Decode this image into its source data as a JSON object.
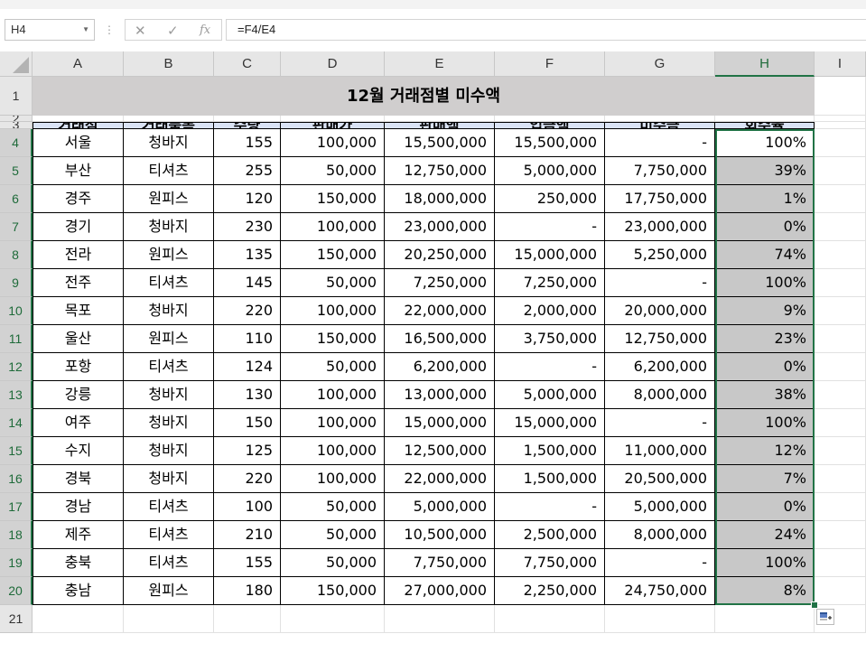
{
  "name_box": "H4",
  "formula": "=F4/E4",
  "columns": [
    "A",
    "B",
    "C",
    "D",
    "E",
    "F",
    "G",
    "H",
    "I"
  ],
  "title": "12월 거래점별 미수액",
  "headers": [
    "거래점",
    "거래품목",
    "수량",
    "판매가",
    "판매액",
    "입금액",
    "미수금",
    "회수율"
  ],
  "rows": [
    [
      "서울",
      "청바지",
      "155",
      "100,000",
      "15,500,000",
      "15,500,000",
      "-",
      "100%"
    ],
    [
      "부산",
      "티셔츠",
      "255",
      "50,000",
      "12,750,000",
      "5,000,000",
      "7,750,000",
      "39%"
    ],
    [
      "경주",
      "원피스",
      "120",
      "150,000",
      "18,000,000",
      "250,000",
      "17,750,000",
      "1%"
    ],
    [
      "경기",
      "청바지",
      "230",
      "100,000",
      "23,000,000",
      "-",
      "23,000,000",
      "0%"
    ],
    [
      "전라",
      "원피스",
      "135",
      "150,000",
      "20,250,000",
      "15,000,000",
      "5,250,000",
      "74%"
    ],
    [
      "전주",
      "티셔츠",
      "145",
      "50,000",
      "7,250,000",
      "7,250,000",
      "-",
      "100%"
    ],
    [
      "목포",
      "청바지",
      "220",
      "100,000",
      "22,000,000",
      "2,000,000",
      "20,000,000",
      "9%"
    ],
    [
      "울산",
      "원피스",
      "110",
      "150,000",
      "16,500,000",
      "3,750,000",
      "12,750,000",
      "23%"
    ],
    [
      "포항",
      "티셔츠",
      "124",
      "50,000",
      "6,200,000",
      "-",
      "6,200,000",
      "0%"
    ],
    [
      "강릉",
      "청바지",
      "130",
      "100,000",
      "13,000,000",
      "5,000,000",
      "8,000,000",
      "38%"
    ],
    [
      "여주",
      "청바지",
      "150",
      "100,000",
      "15,000,000",
      "15,000,000",
      "-",
      "100%"
    ],
    [
      "수지",
      "청바지",
      "125",
      "100,000",
      "12,500,000",
      "1,500,000",
      "11,000,000",
      "12%"
    ],
    [
      "경북",
      "청바지",
      "220",
      "100,000",
      "22,000,000",
      "1,500,000",
      "20,500,000",
      "7%"
    ],
    [
      "경남",
      "티셔츠",
      "100",
      "50,000",
      "5,000,000",
      "-",
      "5,000,000",
      "0%"
    ],
    [
      "제주",
      "티셔츠",
      "210",
      "50,000",
      "10,500,000",
      "2,500,000",
      "8,000,000",
      "24%"
    ],
    [
      "충북",
      "티셔츠",
      "155",
      "50,000",
      "7,750,000",
      "7,750,000",
      "-",
      "100%"
    ],
    [
      "충남",
      "원피스",
      "180",
      "150,000",
      "27,000,000",
      "2,250,000",
      "24,750,000",
      "8%"
    ]
  ],
  "icons": {
    "cancel": "close-icon",
    "enter": "check-icon",
    "function": "fx-icon",
    "quick_analysis": "quick-analysis-icon"
  },
  "colors": {
    "header_fill": "#dae3f5",
    "title_fill": "#d0cece",
    "selection": "#217346",
    "selected_fill": "#c8c8c8"
  }
}
